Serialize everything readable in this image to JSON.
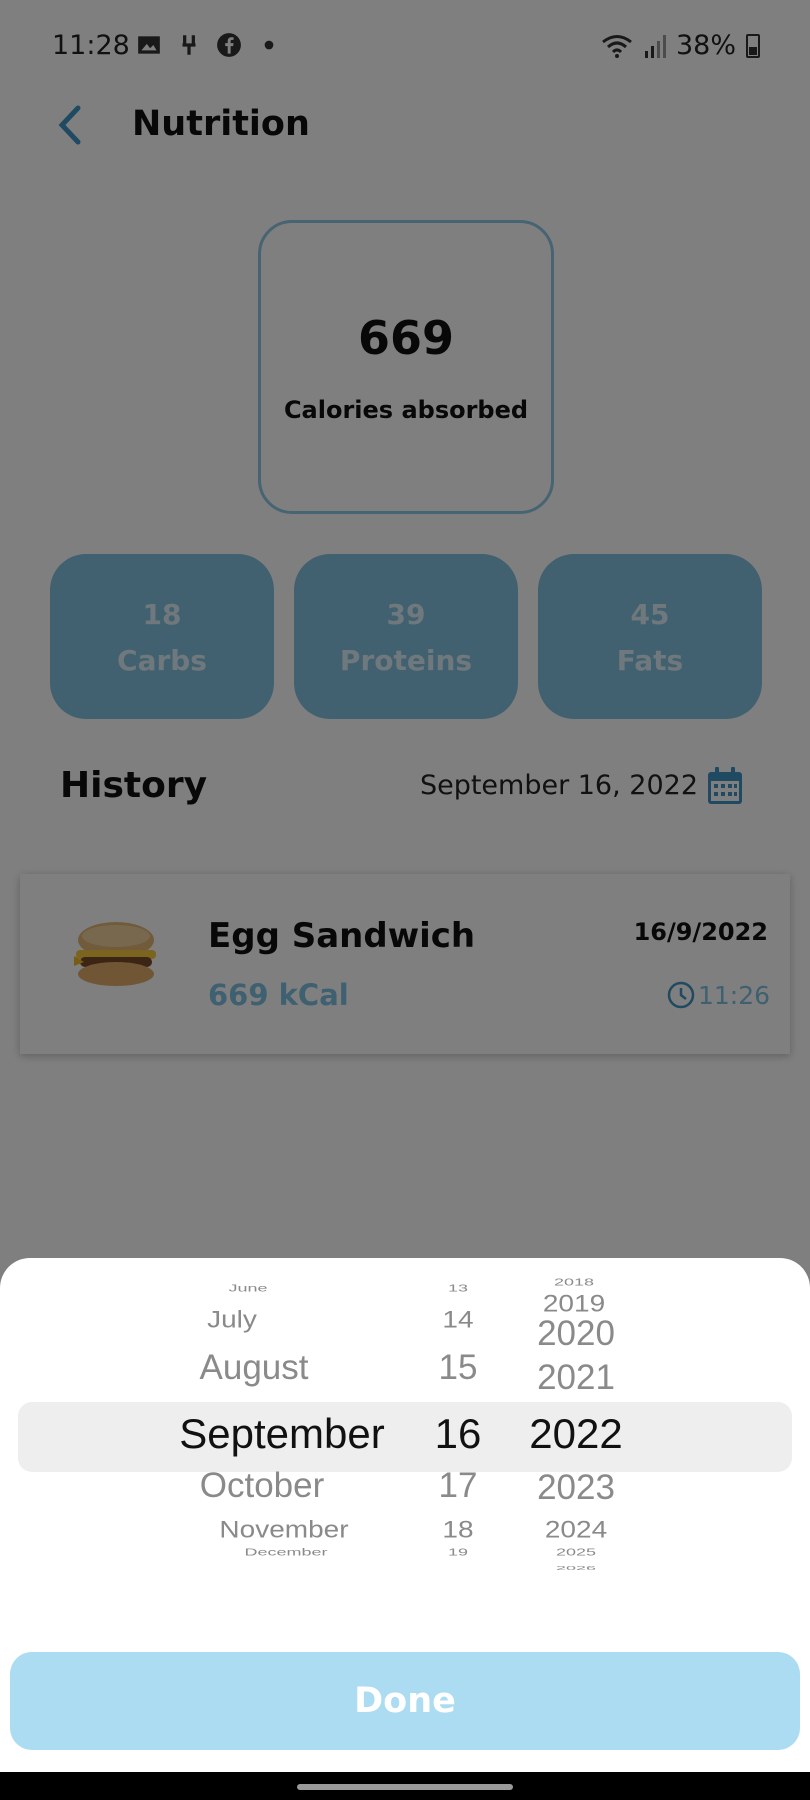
{
  "status_bar": {
    "time": "11:28",
    "battery": "38%",
    "icons": [
      "gallery-icon",
      "usb-debug-icon",
      "facebook-icon",
      "dot-icon",
      "wifi-icon",
      "signal-icon",
      "battery-icon"
    ]
  },
  "header": {
    "title": "Nutrition",
    "back_icon": "chevron-left-icon"
  },
  "calories": {
    "value": "669",
    "label": "Calories absorbed"
  },
  "macros": [
    {
      "value": "18",
      "label": "Carbs"
    },
    {
      "value": "39",
      "label": "Proteins"
    },
    {
      "value": "45",
      "label": "Fats"
    }
  ],
  "history": {
    "title": "History",
    "date": "September 16, 2022",
    "calendar_icon": "calendar-icon"
  },
  "entries": [
    {
      "name": "Egg Sandwich",
      "kcal": "669 kCal",
      "date": "16/9/2022",
      "time": "11:26",
      "image": "egg-sandwich-image"
    }
  ],
  "date_picker": {
    "months": [
      "June",
      "July",
      "August",
      "September",
      "October",
      "November",
      "December"
    ],
    "days": [
      "13",
      "14",
      "15",
      "16",
      "17",
      "18",
      "19"
    ],
    "years": [
      "2018",
      "2019",
      "2020",
      "2021",
      "2022",
      "2023",
      "2024",
      "2025",
      "2026"
    ],
    "selected": {
      "month": "September",
      "day": "16",
      "year": "2022"
    },
    "done_label": "Done"
  },
  "colors": {
    "accent": "#84c2e0",
    "accent_text": "#7ec0e0",
    "done_button": "#acdcf1"
  }
}
